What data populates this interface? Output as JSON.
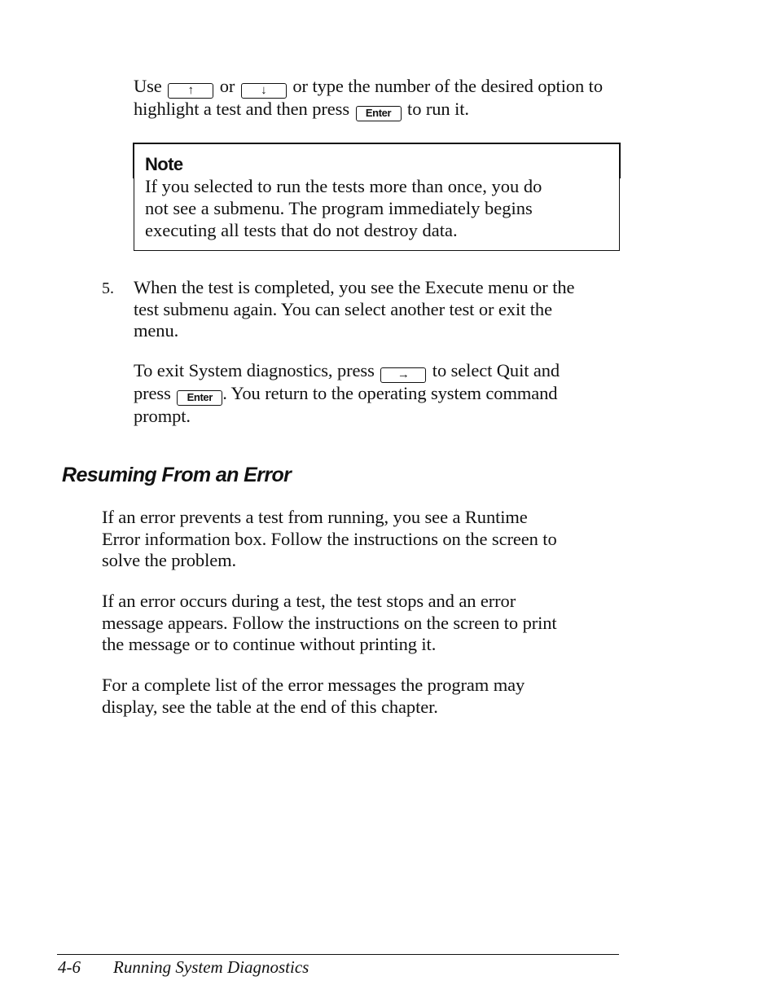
{
  "intro_paragraph": {
    "text_1": "Use",
    "key_up": "↑",
    "text_2": "or",
    "key_down": "↓",
    "text_3": "or type the number of the desired option to",
    "text_4": "highlight a test and then press",
    "key_enter": "Enter",
    "text_5": "to run it."
  },
  "note": {
    "title": "Note",
    "lines": [
      "If you selected to run the tests more than once, you do",
      "not see a submenu. The program immediately begins",
      "executing all tests that do not destroy data."
    ]
  },
  "step_5": {
    "number": "5.",
    "lines": [
      "When the test is completed, you see the Execute menu or the",
      "test submenu again. You can select another test or exit the",
      "menu."
    ]
  },
  "exit_paragraph": {
    "text_1": "To exit System diagnostics, press",
    "key_right": "→",
    "text_2": "to select Quit and",
    "text_3": "press",
    "key_enter": "Enter",
    "text_4": ". You return to the operating system command",
    "text_5": "prompt."
  },
  "section": {
    "heading": "Resuming From an Error",
    "paragraphs": [
      {
        "lines": [
          "If an error prevents a test from running, you see a Runtime",
          "Error information box. Follow the instructions on the screen to",
          "solve the problem."
        ]
      },
      {
        "lines": [
          "If an error occurs during a test, the test stops and an error",
          "message appears. Follow the instructions on the screen to print",
          "the message or to continue without printing it."
        ]
      },
      {
        "lines": [
          "For a complete list of the error messages the program may",
          "display, see the table at the end of this chapter."
        ]
      }
    ]
  },
  "footer": {
    "page_number": "4-6",
    "chapter_title": "Running System Diagnostics"
  }
}
